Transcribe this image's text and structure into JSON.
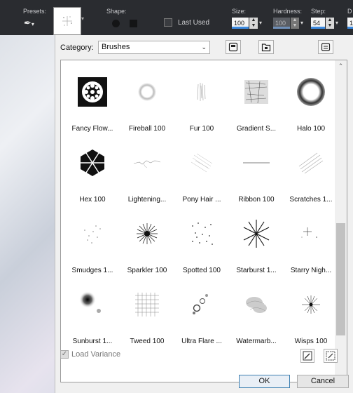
{
  "toolbar": {
    "presets_label": "Presets:",
    "shape_label": "Shape:",
    "last_used_label": "Last Used",
    "size_label": "Size:",
    "size_value": "100",
    "hardness_label": "Hardness:",
    "hardness_value": "100",
    "step_label": "Step:",
    "step_value": "54",
    "density_label": "D",
    "density_value": "1"
  },
  "dialog": {
    "category_label": "Category:",
    "category_value": "Brushes",
    "load_variance_label": "Load Variance",
    "load_variance_checked": true,
    "ok_label": "OK",
    "cancel_label": "Cancel"
  },
  "brushes": [
    {
      "label": "Fancy Flow...",
      "icon": "fancy-flower-icon"
    },
    {
      "label": "Fireball 100",
      "icon": "fireball-icon"
    },
    {
      "label": "Fur 100",
      "icon": "fur-icon"
    },
    {
      "label": "Gradient S...",
      "icon": "gradient-icon"
    },
    {
      "label": "Halo 100",
      "icon": "halo-icon"
    },
    {
      "label": "Hex 100",
      "icon": "hex-icon"
    },
    {
      "label": "Lightening...",
      "icon": "lightning-icon"
    },
    {
      "label": "Pony Hair ...",
      "icon": "pony-hair-icon"
    },
    {
      "label": "Ribbon 100",
      "icon": "ribbon-icon"
    },
    {
      "label": "Scratches 1...",
      "icon": "scratches-icon"
    },
    {
      "label": "Smudges 1...",
      "icon": "smudges-icon"
    },
    {
      "label": "Sparkler 100",
      "icon": "sparkler-icon"
    },
    {
      "label": "Spotted 100",
      "icon": "spotted-icon"
    },
    {
      "label": "Starburst 1...",
      "icon": "starburst-icon"
    },
    {
      "label": "Starry Nigh...",
      "icon": "starry-night-icon"
    },
    {
      "label": "Sunburst 1...",
      "icon": "sunburst-icon"
    },
    {
      "label": "Tweed 100",
      "icon": "tweed-icon"
    },
    {
      "label": "Ultra Flare ...",
      "icon": "ultra-flare-icon"
    },
    {
      "label": "Watermarb...",
      "icon": "watermarble-icon"
    },
    {
      "label": "Wisps 100",
      "icon": "wisps-icon"
    }
  ]
}
